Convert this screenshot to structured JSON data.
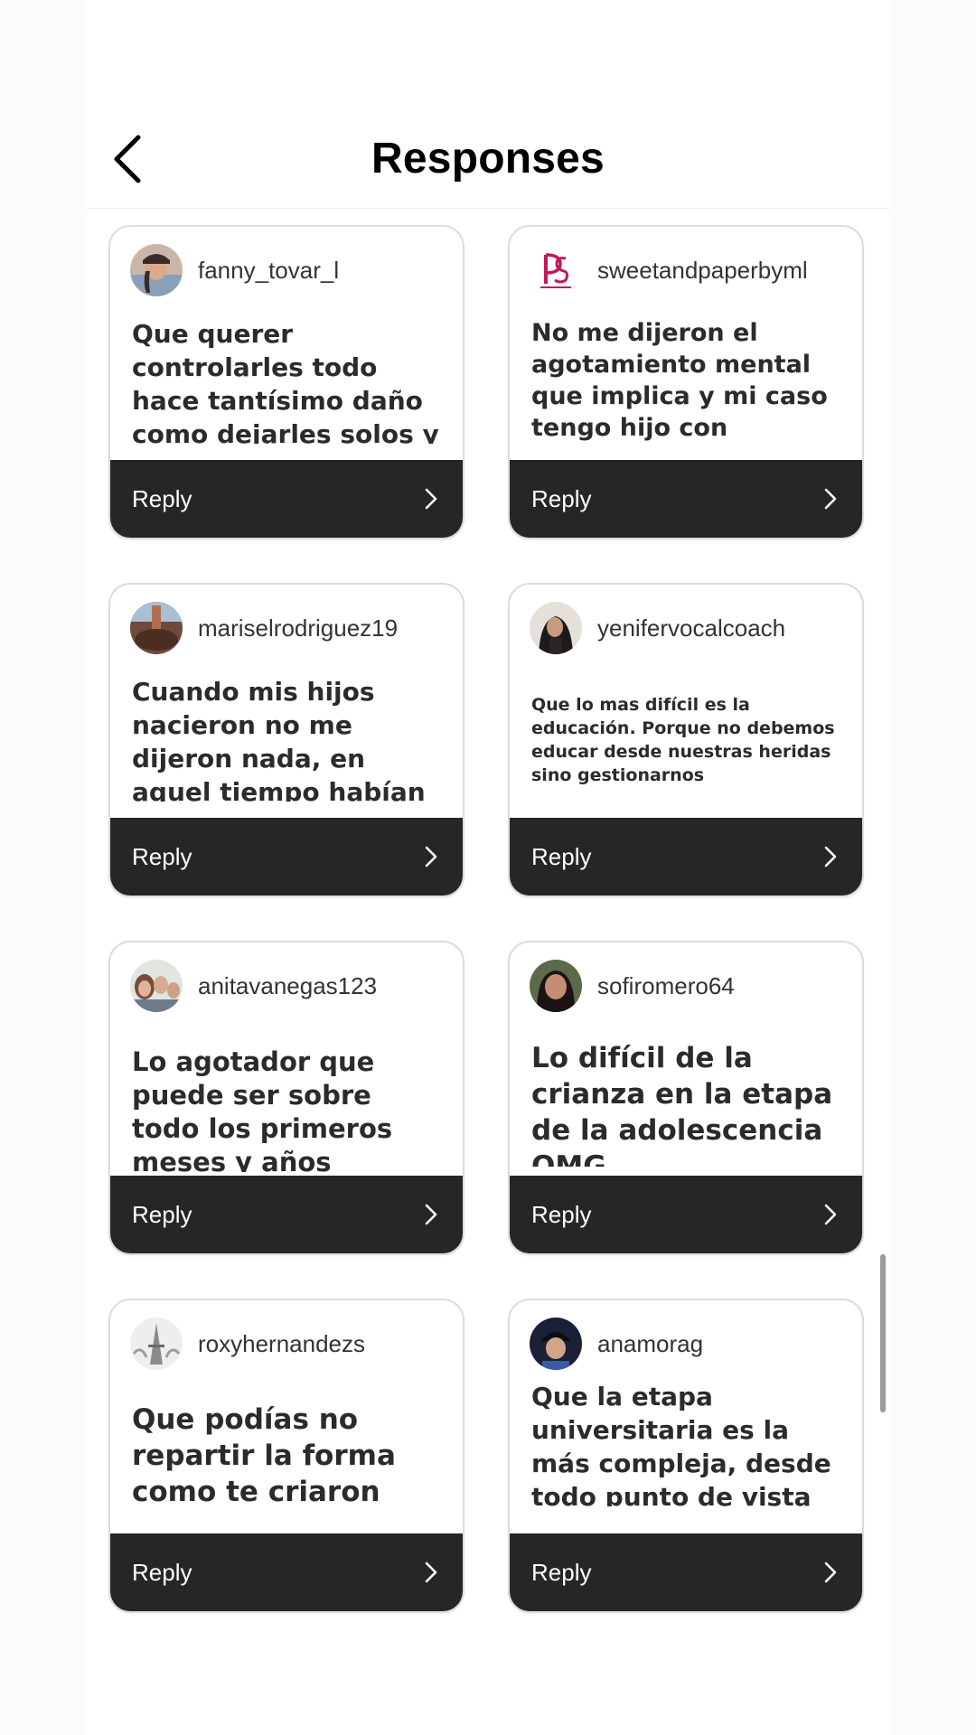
{
  "header": {
    "title": "Responses"
  },
  "responses": [
    {
      "username": "fanny_tovar_l",
      "text": "Que querer controlarles todo hace tantísimo daño como dejarles solos y no escucharles",
      "reply_label": "Reply",
      "avatar_icon": "user-photo"
    },
    {
      "username": "sweetandpaperbyml",
      "text": "No me dijeron el agotamiento mental que implica y mi caso tengo hijo con autismo no verbl",
      "reply_label": "Reply",
      "avatar_icon": "brand-logo"
    },
    {
      "username": "mariselrodriguez19",
      "text": "Cuando mis hijos nacieron no me dijeron nada, en aquel tiempo habían pocas herr",
      "reply_label": "Reply",
      "avatar_icon": "user-photo"
    },
    {
      "username": "yenifervocalcoach",
      "text": "Que lo mas difícil es la educación. Porque no debemos educar desde nuestras heridas sino gestionarnos",
      "reply_label": "Reply",
      "avatar_icon": "user-photo"
    },
    {
      "username": "anitavanegas123",
      "text": "Lo agotador que puede ser sobre todo los primeros meses y años",
      "reply_label": "Reply",
      "avatar_icon": "user-photo"
    },
    {
      "username": "sofiromero64",
      "text": "Lo difícil de la crianza en la etapa de la adolescencia OMG",
      "reply_label": "Reply",
      "avatar_icon": "user-photo"
    },
    {
      "username": "roxyhernandezs",
      "text": "Que podías no repartir la forma como te criaron",
      "reply_label": "Reply",
      "avatar_icon": "user-photo"
    },
    {
      "username": "anamorag",
      "text": "Que la etapa universitaria es la más compleja, desde todo punto de vista",
      "reply_label": "Reply",
      "avatar_icon": "user-photo"
    }
  ],
  "colors": {
    "reply_bar": "#262626",
    "card_border": "#dcdcdc",
    "brand_logo": "#c2185b"
  }
}
